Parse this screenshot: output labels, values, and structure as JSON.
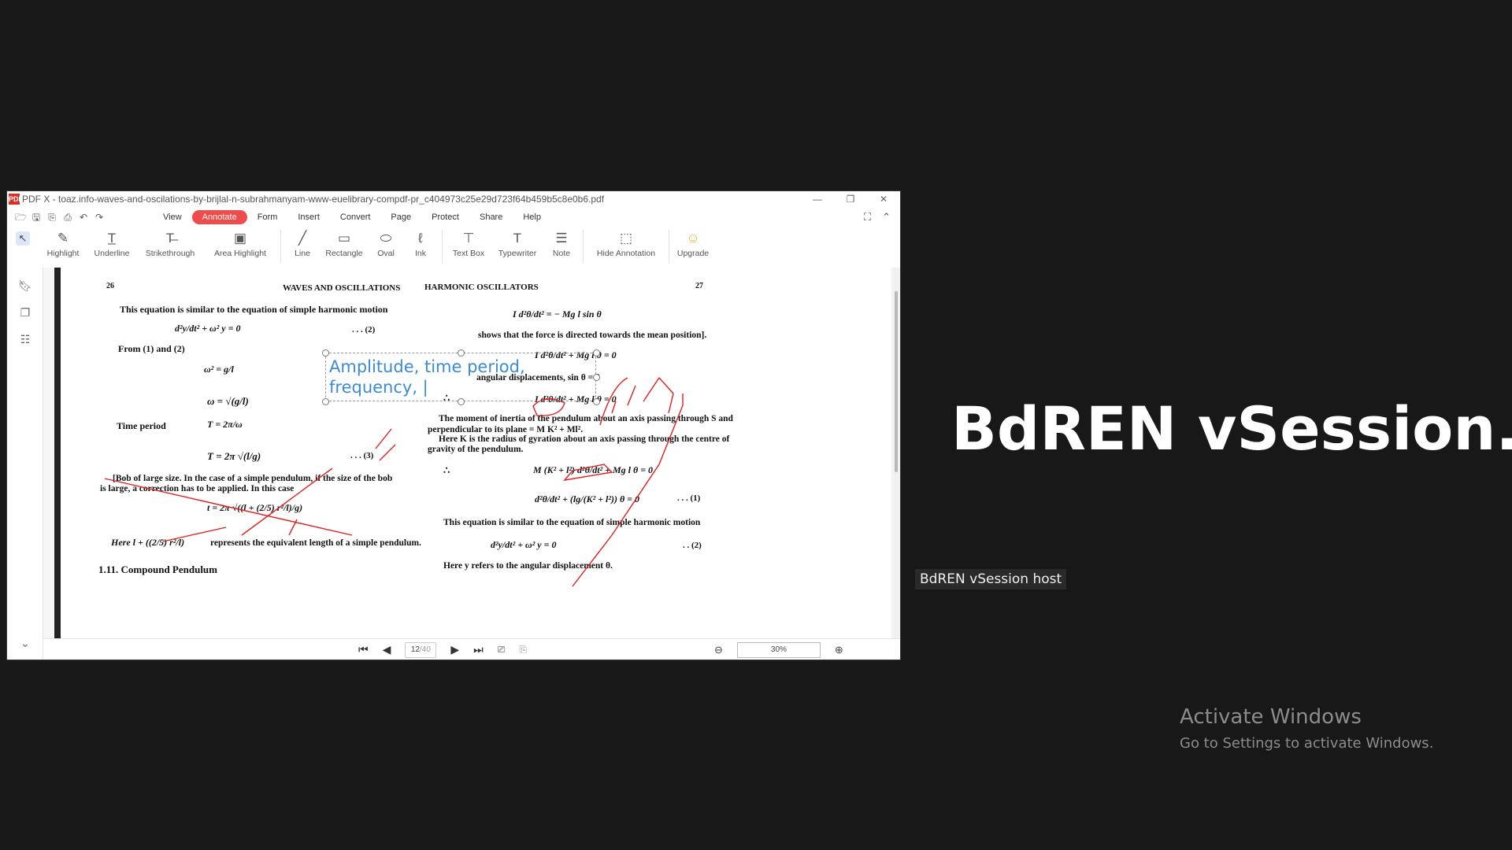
{
  "window": {
    "app_logo": "PDF",
    "title": "PDF X - toaz.info-waves-and-oscilations-by-brijlal-n-subrahmanyam-www-euelibrary-compdf-pr_c404973c25e29d723f64b459b5c8e0b6.pdf",
    "controls": [
      "—",
      "❐",
      "✕"
    ]
  },
  "menu": {
    "items": [
      "View",
      "Annotate",
      "Form",
      "Insert",
      "Convert",
      "Page",
      "Protect",
      "Share",
      "Help"
    ],
    "active": "Annotate"
  },
  "toolbar": {
    "tools": [
      {
        "label": "Highlight",
        "icon": "✎"
      },
      {
        "label": "Underline",
        "icon": "T̲"
      },
      {
        "label": "Strikethrough",
        "icon": "T̶"
      },
      {
        "label": "Area Highlight",
        "icon": "▣"
      },
      {
        "label": "Line",
        "icon": "╱"
      },
      {
        "label": "Rectangle",
        "icon": "▭"
      },
      {
        "label": "Oval",
        "icon": "⬭"
      },
      {
        "label": "Ink",
        "icon": "ℓ"
      },
      {
        "label": "Text Box",
        "icon": "⊤"
      },
      {
        "label": "Typewriter",
        "icon": "T"
      },
      {
        "label": "Note",
        "icon": "☰"
      },
      {
        "label": "Hide Annotation",
        "icon": "⬚"
      },
      {
        "label": "Upgrade",
        "icon": "☺"
      }
    ]
  },
  "status": {
    "page_current": "12",
    "page_total": "/40",
    "zoom": "30%"
  },
  "document": {
    "left_page_number": "26",
    "left_header": "WAVES AND OSCILLATIONS",
    "right_header": "HARMONIC OSCILLATORS",
    "right_page_number": "27",
    "l1": "This equation is similar to the equation of simple harmonic motion",
    "l2": "From (1) and (2)",
    "l3": "Time period",
    "l4": "[Bob of large size. In the case of a simple pendulum, if the size of the bob",
    "l5": "is large, a correction has to be applied. In this case",
    "l6": "represents the equivalent length of a simple pendulum.",
    "l7": "1.11.  Compound Pendulum",
    "eq1_num": ". . . (2)",
    "eq3_num": ". . . (3)",
    "r1": "shows that the force is directed towards the mean position].",
    "r2": "angular displacements, sin θ = θ",
    "r3": "The moment of inertia of the pendulum about an axis passing through S and",
    "r4": "perpendicular to its plane = M K² + Ml².",
    "r5": "Here K is the radius of gyration about an axis passing through the centre of",
    "r6": "gravity of the pendulum.",
    "r7": "This equation is similar to the equation of simple harmonic motion",
    "r8": "Here y  refers to the angular displacement θ.",
    "req1_num": ". . . (1)",
    "req2_num": ". . (2)",
    "m_l1": "d²y/dt² + ω² y = 0",
    "m_l2": "ω² = g/l",
    "m_l3": "ω = √(g/l)",
    "m_l4": "T = 2π/ω",
    "m_l5": "T = 2π √(l/g)",
    "m_l6": "t = 2π √((l + (2/5) r²/l)/g)",
    "m_l7": "Here l + ((2/5) r²/l)",
    "m_r1": "I d²θ/dt² = − Mg  l  sin θ",
    "m_r2": "I d²θ/dt² + Mg  l  θ = 0",
    "m_r3": "I d²θ/dt² + Mg l θ = 0",
    "m_r4": "M (K² + l²) d²θ/dt² + Mg l θ = 0",
    "m_r5": "d²θ/dt² + (lg/(K² + l²)) θ = 0",
    "m_r6": "d²y/dt² + ω² y = 0",
    "therefore": "∴"
  },
  "annotation": {
    "text": "Amplitude, time period, frequency, |"
  },
  "overlay": {
    "vsession_title": "BdREN  vSession...",
    "host_label": "BdREN vSession host",
    "activate_title": "Activate Windows",
    "activate_sub": "Go to Settings to activate Windows."
  }
}
